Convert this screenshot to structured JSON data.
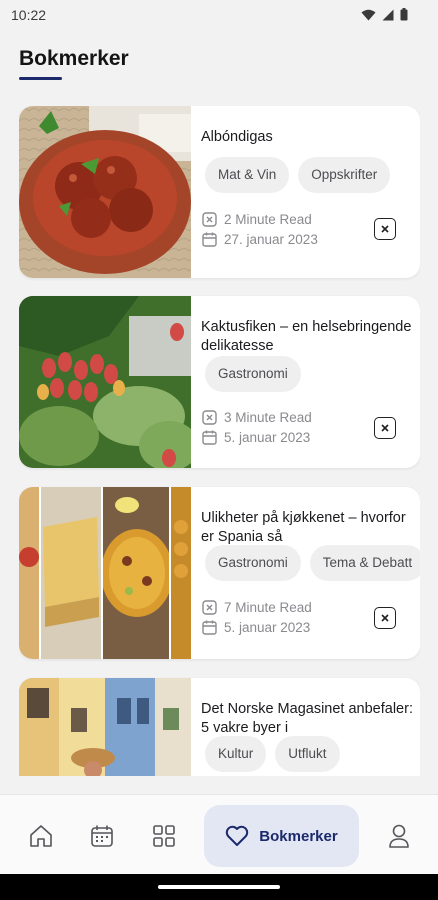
{
  "status_bar": {
    "time": "10:22"
  },
  "page": {
    "title": "Bokmerker"
  },
  "articles": [
    {
      "title": "Albóndigas",
      "tags": [
        "Mat & Vin",
        "Oppskrifter"
      ],
      "read_time": "2 Minute Read",
      "date": "27. januar 2023"
    },
    {
      "title": "Kaktusfiken – en helsebringende delikatesse",
      "tags": [
        "Gastronomi"
      ],
      "read_time": "3 Minute Read",
      "date": "5. januar 2023"
    },
    {
      "title": "Ulikheter på kjøkkenet – hvorfor er Spania så",
      "tags": [
        "Gastronomi",
        "Tema & Debatt"
      ],
      "read_time": "7 Minute Read",
      "date": "5. januar 2023"
    },
    {
      "title": "Det Norske Magasinet anbefaler: 5 vakre byer i",
      "tags": [
        "Kultur",
        "Utflukt"
      ]
    }
  ],
  "bottom_nav": {
    "items": [
      "home-icon",
      "calendar-icon",
      "grid-icon",
      "heart-icon",
      "profile-icon"
    ],
    "active_label": "Bokmerker"
  },
  "colors": {
    "accent": "#1c2a6b",
    "active_bg": "#e3e6f3",
    "tag_bg": "#efefef"
  }
}
